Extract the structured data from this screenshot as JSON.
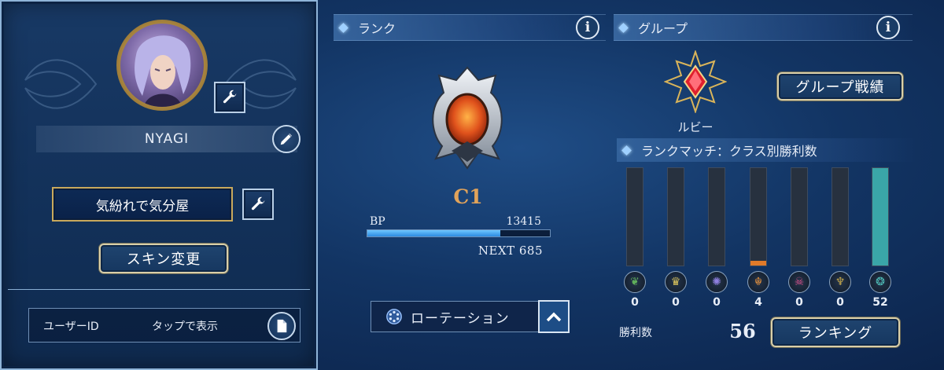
{
  "profile": {
    "player_name": "NYAGI",
    "title": "気紛れで気分屋",
    "skin_change_label": "スキン変更",
    "user_id_label": "ユーザーID",
    "user_id_action": "タップで表示"
  },
  "rank": {
    "header": "ランク",
    "info_label": "i",
    "tier": "C1",
    "bp_label": "BP",
    "bp_value": "13415",
    "bp_progress": 0.73,
    "next_label": "NEXT 685",
    "rotation_label": "ローテーション"
  },
  "group": {
    "header": "グループ",
    "info_label": "i",
    "group_name": "ルビー",
    "group_record_label": "グループ戦績",
    "class_wins_header": "ランクマッチ：クラス別勝利数",
    "classes": [
      {
        "icon": "leaf-icon",
        "glyph": "❦",
        "color": "#5fae5a",
        "wins": "0",
        "fill": 0
      },
      {
        "icon": "crown-icon",
        "glyph": "♛",
        "color": "#d9c25a",
        "wins": "0",
        "fill": 0
      },
      {
        "icon": "sigil-icon",
        "glyph": "✺",
        "color": "#8f7fe0",
        "wins": "0",
        "fill": 0
      },
      {
        "icon": "dragon-icon",
        "glyph": "☬",
        "color": "#d98a3c",
        "wins": "4",
        "fill": 0.045
      },
      {
        "icon": "skull-icon",
        "glyph": "☠",
        "color": "#d94f8a",
        "wins": "0",
        "fill": 0
      },
      {
        "icon": "vampire-icon",
        "glyph": "♆",
        "color": "#c6a84a",
        "wins": "0",
        "fill": 0
      },
      {
        "icon": "swirl-icon",
        "glyph": "❂",
        "color": "#4fbfb8",
        "wins": "52",
        "fill": 1
      }
    ],
    "bar_colors": {
      "active": "#e07a2a",
      "max": "#3aa6a8"
    },
    "wins_label": "勝利数",
    "wins_total": "56",
    "ranking_label": "ランキング"
  }
}
